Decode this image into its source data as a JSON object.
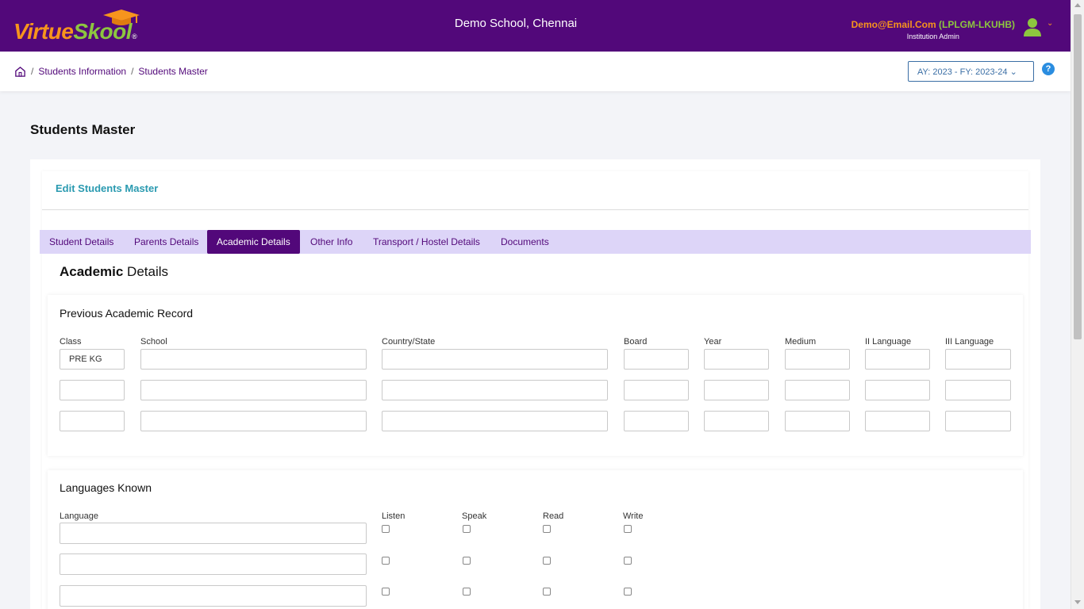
{
  "header": {
    "logo": {
      "virtue": "Virtue",
      "skool": "Skool",
      "reg": "®"
    },
    "school_name": "Demo School, Chennai",
    "user_email": "Demo@Email.Com",
    "user_code": "(LPLGM-LKUHB)",
    "user_role": "Institution Admin",
    "user_chevron": "⌄"
  },
  "breadcrumb": {
    "items": [
      "Students Information",
      "Students Master"
    ],
    "separator": "/"
  },
  "ay_select": {
    "value": "AY: 2023 - FY: 2023-24",
    "chevron": "⌄"
  },
  "help_label": "?",
  "page_title": "Students Master",
  "edit_title": "Edit Students Master",
  "tabs": [
    {
      "label": "Student Details",
      "active": false
    },
    {
      "label": "Parents Details",
      "active": false
    },
    {
      "label": "Academic Details",
      "active": true
    },
    {
      "label": "Other Info",
      "active": false
    },
    {
      "label": "Transport / Hostel Details",
      "active": false
    },
    {
      "label": "Documents",
      "active": false
    }
  ],
  "section_heading": {
    "bold": "Academic",
    "rest": " Details"
  },
  "previous_record": {
    "title": "Previous Academic Record",
    "columns": [
      "Class",
      "School",
      "Country/State",
      "Board",
      "Year",
      "Medium",
      "II Language",
      "III Language"
    ],
    "rows": [
      [
        "PRE KG",
        "",
        "",
        "",
        "",
        "",
        "",
        ""
      ],
      [
        "",
        "",
        "",
        "",
        "",
        "",
        "",
        ""
      ],
      [
        "",
        "",
        "",
        "",
        "",
        "",
        "",
        ""
      ]
    ]
  },
  "languages_known": {
    "title": "Languages Known",
    "columns": [
      "Language",
      "Listen",
      "Speak",
      "Read",
      "Write"
    ],
    "rows": [
      {
        "language": "",
        "listen": false,
        "speak": false,
        "read": false,
        "write": false
      },
      {
        "language": "",
        "listen": false,
        "speak": false,
        "read": false,
        "write": false
      },
      {
        "language": "",
        "listen": false,
        "speak": false,
        "read": false,
        "write": false
      }
    ]
  },
  "colors": {
    "primary": "#52087a",
    "accent_orange": "#f7941d",
    "accent_green": "#8dc63f",
    "tab_bar": "#ddd5f8",
    "link_teal": "#2a9ab0"
  }
}
